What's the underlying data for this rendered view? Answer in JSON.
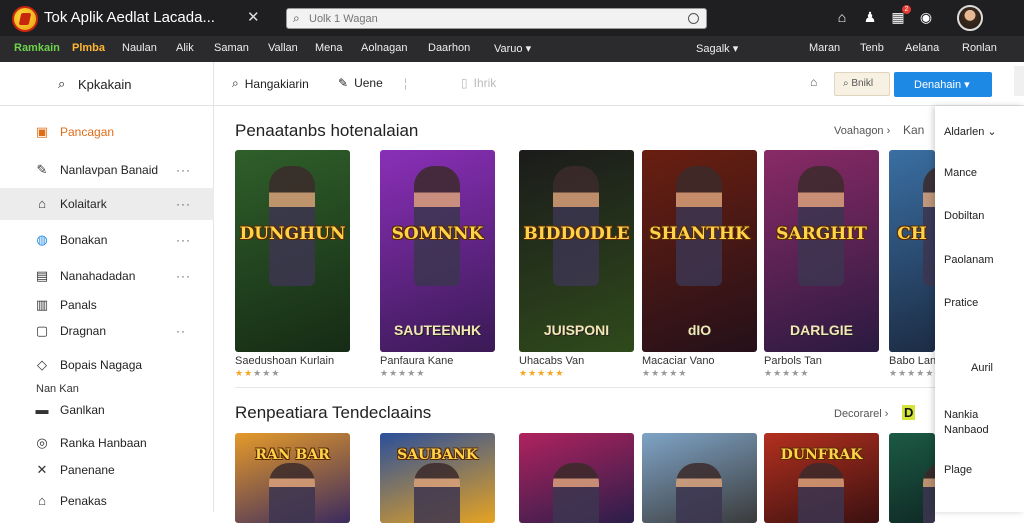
{
  "window": {
    "title": "Tok Aplik Aedlat Lacada...",
    "search_placeholder": "Uolk 1 Wagan"
  },
  "menubar": {
    "items": [
      "Ramkain",
      "Plmba",
      "Naulan",
      "Alik",
      "Saman",
      "Vallan",
      "Mena",
      "Aolnagan",
      "Daarhon",
      "Varuo",
      "Sagalk",
      "Maran",
      "Tenb",
      "Aelana",
      "Ronlan"
    ]
  },
  "sidebar": {
    "search_label": "Kpkakain",
    "items": [
      {
        "label": "Pancagan",
        "icon": "store-icon"
      },
      {
        "label": "Nanlavpan Banaid",
        "icon": "pencil-icon"
      },
      {
        "label": "Kolaitark",
        "icon": "tag-icon"
      },
      {
        "label": "Bonakan",
        "icon": "globe-icon"
      },
      {
        "label": "Nanahadadan",
        "icon": "list-icon"
      },
      {
        "label": "Panals",
        "icon": "chart-icon"
      },
      {
        "label": "Dragnan",
        "icon": "chat-icon"
      },
      {
        "label": "Bopais Nagaga",
        "icon": "tag-icon"
      },
      {
        "label": "Ganlkan",
        "icon": "folder-icon"
      },
      {
        "label": "Ranka Hanbaan",
        "icon": "gear-icon"
      },
      {
        "label": "Panenane",
        "icon": "tools-icon"
      },
      {
        "label": "Penakas",
        "icon": "pin-icon"
      }
    ],
    "section_label": "Nan Kan"
  },
  "toolbar": {
    "btn1": "Hangakiarin",
    "btn2": "Uene",
    "btn3": "Ihrik",
    "filter_label": "Bnikl",
    "primary_label": "Denahain"
  },
  "sections": [
    {
      "title": "Penaatanbs hotenalaian",
      "link": "Voahagon",
      "link2": "Kan",
      "cards": [
        {
          "name": "Saedushoan Kurlain",
          "logo": "DUNGHUN",
          "sublogo": "",
          "bg": "#2f5f2a",
          "bg2": "#162b15",
          "stars_on": 2
        },
        {
          "name": "Panfaura Kane",
          "logo": "SOMNNK",
          "sublogo": "SAUTEENHK",
          "bg": "#8a2fb8",
          "bg2": "#3a1a55",
          "stars_on": 0
        },
        {
          "name": "Uhacabs Van",
          "logo": "BIDDODLE",
          "sublogo": "JUISPONI",
          "bg": "#1b1b1b",
          "bg2": "#2f4a1b",
          "stars_on": 5
        },
        {
          "name": "Macaciar Vano",
          "logo": "SHANTHK",
          "sublogo": "dIO",
          "bg": "#6a1f10",
          "bg2": "#24101a",
          "stars_on": 0
        },
        {
          "name": "Parbols Tan",
          "logo": "SARGHIT",
          "sublogo": "DARLGIE",
          "bg": "#8a2a66",
          "bg2": "#2a1a40",
          "stars_on": 0
        },
        {
          "name": "Babo Lan",
          "logo": "CH",
          "sublogo": "",
          "bg": "#3a6fa3",
          "bg2": "#1c2c44",
          "stars_on": 0
        }
      ]
    },
    {
      "title": "Renpeatiara Tendeclaains",
      "link": "Decorarel",
      "link2": "D",
      "cards": [
        {
          "logo": "RAN BAR",
          "bg": "#e59a2a",
          "bg2": "#3b2a5f"
        },
        {
          "logo": "SAUBANK",
          "bg": "#2a4f9b",
          "bg2": "#e6a322"
        },
        {
          "logo": "",
          "bg": "#b0225e",
          "bg2": "#2a1e4a"
        },
        {
          "logo": "",
          "bg": "#7fa4c7",
          "bg2": "#3a3a3a"
        },
        {
          "logo": "DUNFRAK",
          "bg": "#b3301f",
          "bg2": "#3a1010"
        },
        {
          "logo": "",
          "bg": "#1c5a44",
          "bg2": "#0f2a25"
        }
      ]
    }
  ],
  "dropdown": {
    "header": "Aldarlen",
    "items": [
      "Mance",
      "Dobiltan",
      "Paolanam",
      "Pratice",
      "Auril",
      "Nankia Nanbaod",
      "Plage"
    ]
  },
  "colors": {
    "accent": "#1e88e5",
    "menubar_bg": "#2b2b2e",
    "topbar_bg": "#1f1f22",
    "star": "#f5a623"
  }
}
